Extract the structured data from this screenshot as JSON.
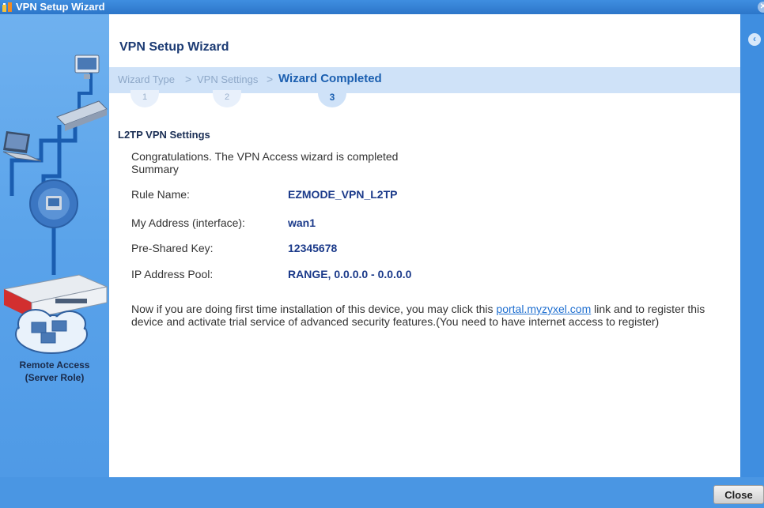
{
  "window": {
    "title": "VPN Setup Wizard"
  },
  "main": {
    "title": "VPN Setup Wizard",
    "steps": [
      {
        "label": "Wizard Type",
        "number": "1"
      },
      {
        "label": "VPN Settings",
        "number": "2"
      },
      {
        "label": "Wizard Completed",
        "number": "3"
      }
    ],
    "section_title": "L2TP VPN Settings",
    "congrats": "Congratulations. The VPN Access wizard is completed",
    "summary": "Summary",
    "rows": [
      {
        "label": "Rule Name:",
        "value": "EZMODE_VPN_L2TP"
      },
      {
        "label": "My Address (interface):",
        "value": "wan1"
      },
      {
        "label": "Pre-Shared Key:",
        "value": "12345678"
      },
      {
        "label": "IP Address Pool:",
        "value": "RANGE, 0.0.0.0 - 0.0.0.0"
      }
    ],
    "note_before": "Now if you are doing first time installation of this device, you may click this ",
    "note_link": "portal.myzyxel.com",
    "note_after": " link and to register this device and activate trial service of advanced security features.(You need to have internet access to register)"
  },
  "sidebar": {
    "caption_line1": "Remote Access",
    "caption_line2": "(Server Role)"
  },
  "footer": {
    "close_label": "Close"
  },
  "colors": {
    "accent": "#3f8ee0",
    "title": "#1b3a73",
    "value": "#1b3a8a",
    "steps_bar": "#cfe2f8"
  }
}
